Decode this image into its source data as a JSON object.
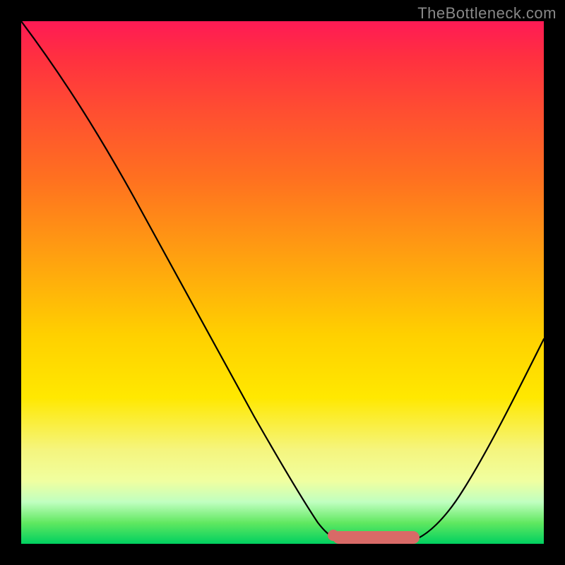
{
  "watermark": "TheBottleneck.com",
  "colors": {
    "frame": "#000000",
    "curve": "#000000",
    "flat_band": "#d86a67",
    "gradient_top": "#ff1a55",
    "gradient_bottom": "#00d060"
  },
  "chart_data": {
    "type": "line",
    "title": "",
    "xlabel": "",
    "ylabel": "",
    "xlim": [
      0,
      100
    ],
    "ylim": [
      0,
      100
    ],
    "annotations": [
      "TheBottleneck.com"
    ],
    "series": [
      {
        "name": "curve",
        "x": [
          0,
          8,
          15,
          22,
          30,
          38,
          45,
          52,
          55,
          58,
          62,
          66,
          70,
          74,
          78,
          83,
          88,
          93,
          100
        ],
        "values": [
          100,
          90,
          80,
          70,
          58,
          46,
          34,
          20,
          12,
          6,
          2,
          1,
          1,
          1,
          2,
          6,
          14,
          24,
          40
        ]
      },
      {
        "name": "flat_minimum_band",
        "x": [
          58,
          78
        ],
        "values": [
          1,
          1
        ]
      }
    ],
    "minimum_point": {
      "x": 70,
      "value": 1
    }
  }
}
